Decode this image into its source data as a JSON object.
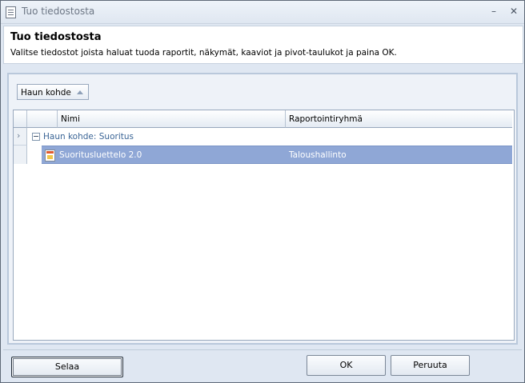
{
  "window": {
    "title": "Tuo tiedostosta"
  },
  "header": {
    "title": "Tuo tiedostosta",
    "description": "Valitse tiedostot joista haluat tuoda raportit, näkymät, kaaviot ja pivot-taulukot ja paina OK."
  },
  "groupby": {
    "label": "Haun kohde"
  },
  "grid": {
    "columns": [
      "Nimi",
      "Raportointiryhmä"
    ],
    "group_label": "Haun kohde: Suoritus",
    "rows": [
      {
        "name": "Suoritusluettelo 2.0",
        "group": "Taloushallinto"
      }
    ]
  },
  "buttons": {
    "browse": "Selaa",
    "ok": "OK",
    "cancel": "Peruuta"
  },
  "icons": {
    "window_menu": "document-icon",
    "row_file": "report-file-icon",
    "expand": "chevron-right-icon"
  }
}
